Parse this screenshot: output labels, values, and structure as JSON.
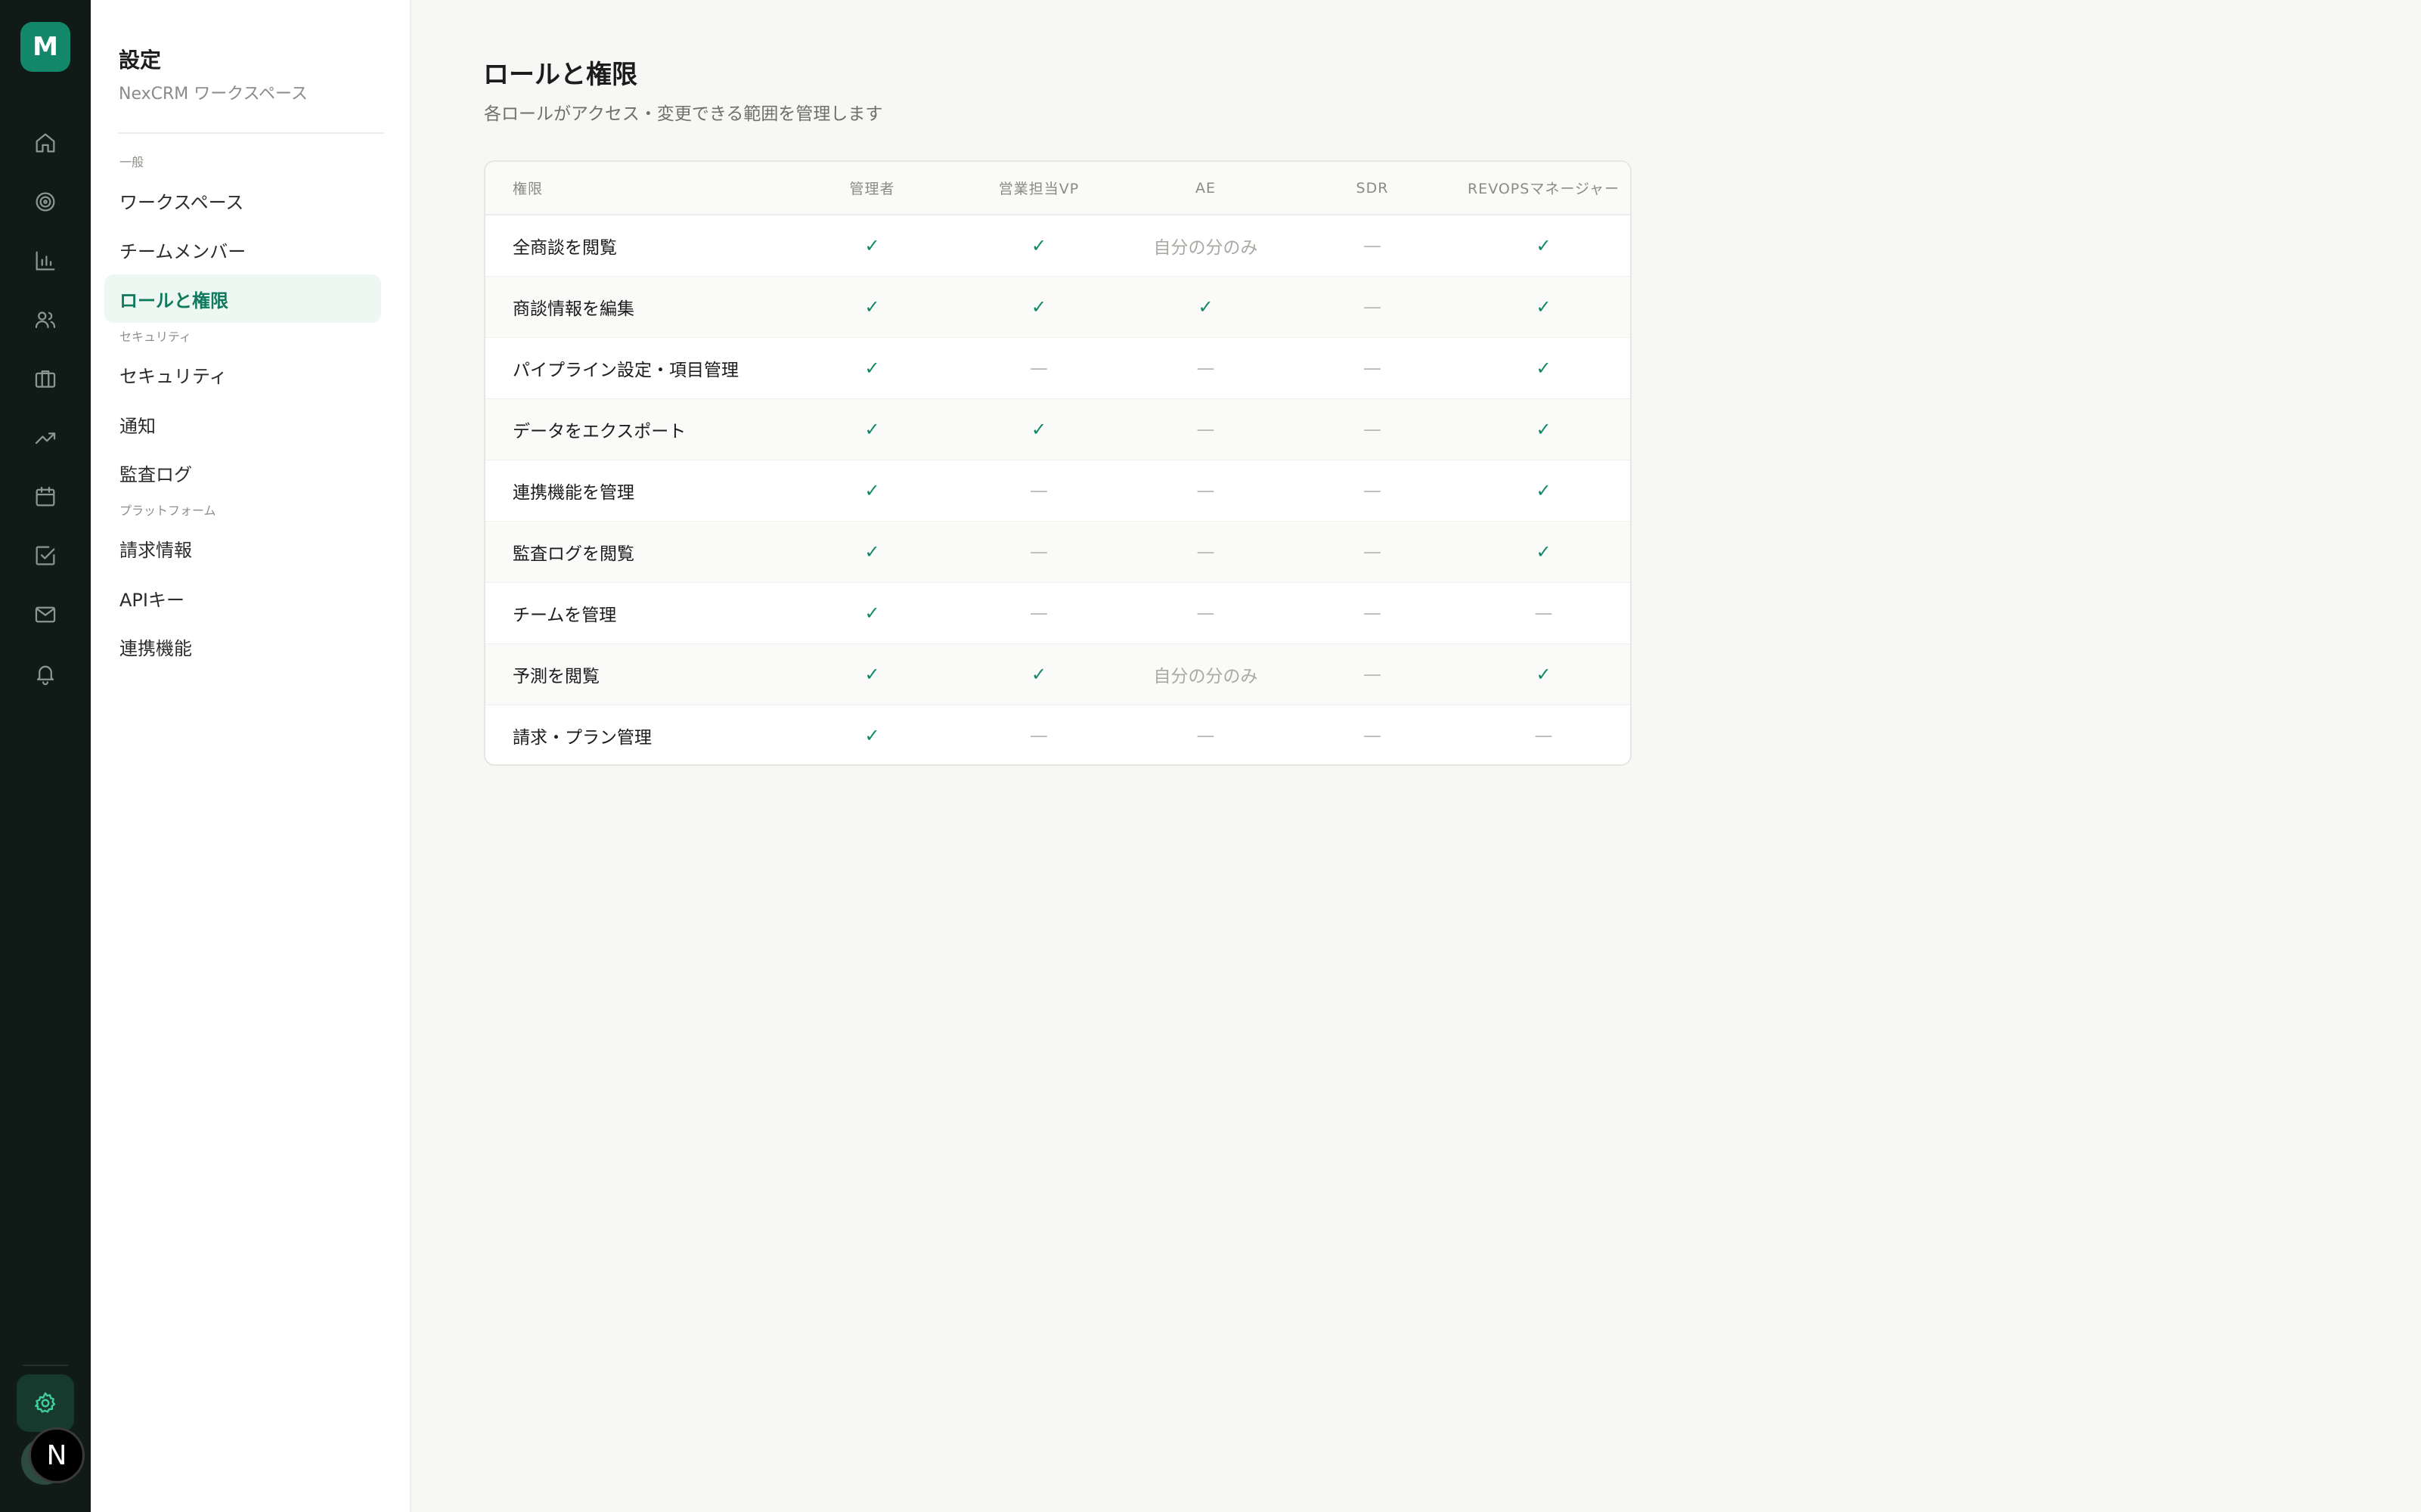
{
  "logo": {
    "letter": "M",
    "color": "#12876a"
  },
  "rail": {
    "icons": [
      "home-icon",
      "target-icon",
      "bar-chart-icon",
      "users-icon",
      "briefcase-icon",
      "trending-up-icon",
      "calendar-icon",
      "check-square-icon",
      "mail-icon",
      "bell-icon"
    ],
    "settings_icon": "gear-icon",
    "avatar_letter": "N"
  },
  "sidebar": {
    "title": "設定",
    "subtitle": "NexCRM ワークスペース",
    "sections": [
      {
        "label": "一般"
      },
      {
        "label": "セキュリティ"
      },
      {
        "label": "プラットフォーム"
      }
    ],
    "items": [
      {
        "label": "ワークスペース"
      },
      {
        "label": "チームメンバー"
      },
      {
        "label": "ロールと権限",
        "active": true
      },
      {
        "label": "セキュリティ"
      },
      {
        "label": "通知"
      },
      {
        "label": "監査ログ"
      },
      {
        "label": "請求情報"
      },
      {
        "label": "APIキー"
      },
      {
        "label": "連携機能"
      }
    ]
  },
  "main": {
    "title": "ロールと権限",
    "subtitle": "各ロールがアクセス・変更できる範囲を管理します",
    "table": {
      "headers": [
        "権限",
        "管理者",
        "営業担当VP",
        "AE",
        "SDR",
        "REVOPSマネージャー"
      ],
      "rows": [
        {
          "label": "全商談を閲覧",
          "cells": [
            "✓",
            "✓",
            "自分の分のみ",
            "—",
            "✓"
          ]
        },
        {
          "label": "商談情報を編集",
          "cells": [
            "✓",
            "✓",
            "✓",
            "—",
            "✓"
          ]
        },
        {
          "label": "パイプライン設定・項目管理",
          "cells": [
            "✓",
            "—",
            "—",
            "—",
            "✓"
          ]
        },
        {
          "label": "データをエクスポート",
          "cells": [
            "✓",
            "✓",
            "—",
            "—",
            "✓"
          ]
        },
        {
          "label": "連携機能を管理",
          "cells": [
            "✓",
            "—",
            "—",
            "—",
            "✓"
          ]
        },
        {
          "label": "監査ログを閲覧",
          "cells": [
            "✓",
            "—",
            "—",
            "—",
            "✓"
          ]
        },
        {
          "label": "チームを管理",
          "cells": [
            "✓",
            "—",
            "—",
            "—",
            "—"
          ]
        },
        {
          "label": "予測を閲覧",
          "cells": [
            "✓",
            "✓",
            "自分の分のみ",
            "—",
            "✓"
          ]
        },
        {
          "label": "請求・プラン管理",
          "cells": [
            "✓",
            "—",
            "—",
            "—",
            "—"
          ]
        }
      ]
    }
  }
}
